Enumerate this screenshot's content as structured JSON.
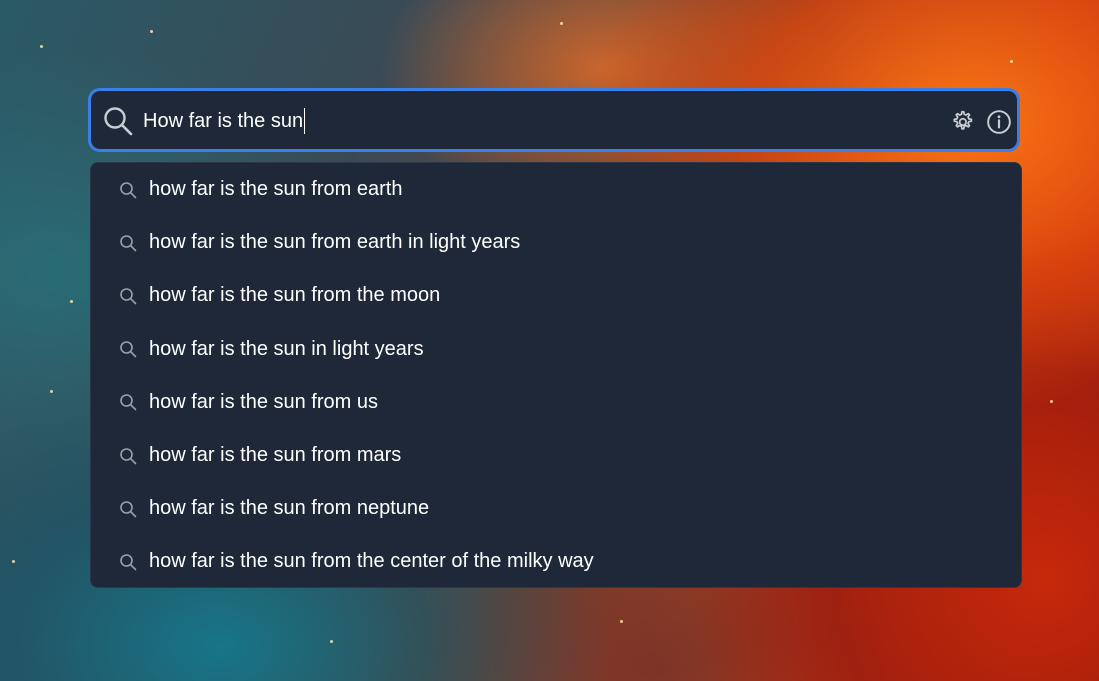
{
  "search": {
    "query": "How far is the sun",
    "accent_color": "#3a7ee8",
    "lead_icon": "search-icon",
    "settings_icon": "gear-icon",
    "info_icon": "info-icon"
  },
  "suggestions": [
    {
      "text": "how far is the sun from earth",
      "icon": "search-icon"
    },
    {
      "text": "how far is the sun from earth in light years",
      "icon": "search-icon"
    },
    {
      "text": "how far is the sun from the moon",
      "icon": "search-icon"
    },
    {
      "text": "how far is the sun in light years",
      "icon": "search-icon"
    },
    {
      "text": "how far is the sun from us",
      "icon": "search-icon"
    },
    {
      "text": "how far is the sun from mars",
      "icon": "search-icon"
    },
    {
      "text": "how far is the sun from neptune",
      "icon": "search-icon"
    },
    {
      "text": "how far is the sun from the center of the milky way",
      "icon": "search-icon"
    }
  ]
}
